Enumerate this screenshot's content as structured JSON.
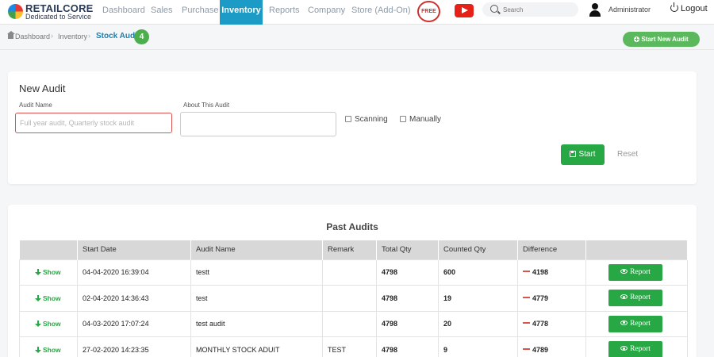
{
  "brand": {
    "title": "RETAILCORE",
    "tagline": "Dedicated to Service"
  },
  "nav": {
    "items": [
      {
        "label": "Dashboard"
      },
      {
        "label": "Sales"
      },
      {
        "label": "Purchase"
      },
      {
        "label": "Inventory",
        "active": true
      },
      {
        "label": "Reports"
      },
      {
        "label": "Company"
      },
      {
        "label": "Store (Add-On)"
      }
    ],
    "free_badge": "FREE",
    "youtube_icon": "youtube-icon",
    "search_placeholder": "Search",
    "user": "Administrator",
    "logout": "Logout"
  },
  "breadcrumb": {
    "items": [
      "Dashboard",
      "Inventory",
      "Stock Audit"
    ],
    "count": "4",
    "new_audit_button": "Start New Audit"
  },
  "new_audit": {
    "title": "New Audit",
    "audit_name_label": "Audit Name",
    "audit_name_placeholder": "Full year audit, Quarterly stock audit",
    "about_label": "About This Audit",
    "scanning_label": "Scanning",
    "manually_label": "Manually",
    "start_button": "Start",
    "reset_button": "Reset"
  },
  "past_audits": {
    "title": "Past Audits",
    "columns": [
      "",
      "Start Date",
      "Audit Name",
      "Remark",
      "Total Qty",
      "Counted Qty",
      "Difference",
      ""
    ],
    "show_label": "Show",
    "report_label": "Report",
    "rows": [
      {
        "start_date": "04-04-2020 16:39:04",
        "audit_name": "testt",
        "remark": "",
        "total_qty": "4798",
        "counted_qty": "600",
        "difference": "4198"
      },
      {
        "start_date": "02-04-2020 14:36:43",
        "audit_name": "test",
        "remark": "",
        "total_qty": "4798",
        "counted_qty": "19",
        "difference": "4779"
      },
      {
        "start_date": "04-03-2020 17:07:24",
        "audit_name": "test audit",
        "remark": "",
        "total_qty": "4798",
        "counted_qty": "20",
        "difference": "4778"
      },
      {
        "start_date": "27-02-2020 14:23:35",
        "audit_name": "MONTHLY STOCK ADUIT",
        "remark": "TEST",
        "total_qty": "4798",
        "counted_qty": "9",
        "difference": "4789"
      }
    ]
  },
  "colors": {
    "accent": "#1b9bc5",
    "success": "#28a745",
    "danger": "#d9534f"
  }
}
